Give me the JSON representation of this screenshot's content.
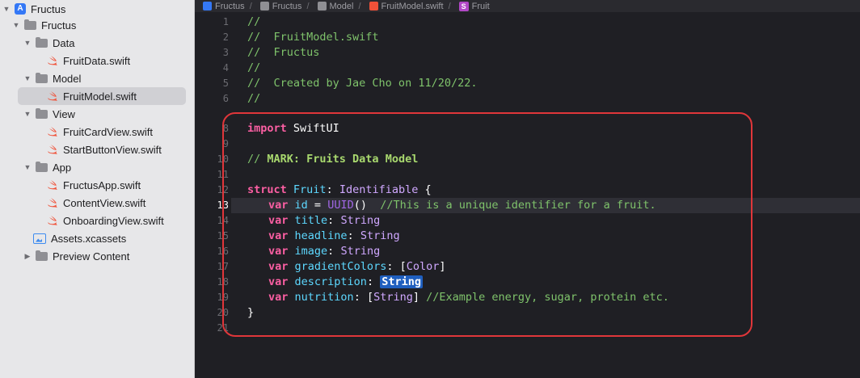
{
  "navigator": {
    "project": "Fructus",
    "group_root": "Fructus",
    "groups": {
      "data": "Data",
      "model": "Model",
      "view": "View",
      "app": "App"
    },
    "files": {
      "fruit_data": "FruitData.swift",
      "fruit_model": "FruitModel.swift",
      "fruit_card_view": "FruitCardView.swift",
      "start_button_view": "StartButtonView.swift",
      "fructus_app": "FructusApp.swift",
      "content_view": "ContentView.swift",
      "onboarding_view": "OnboardingView.swift",
      "assets": "Assets.xcassets",
      "preview_content": "Preview Content"
    }
  },
  "jumpbar": {
    "items": [
      "Fructus",
      "Fructus",
      "Model",
      "FruitModel.swift",
      "Fruit"
    ],
    "separator": "/"
  },
  "editor": {
    "line_numbers": [
      "1",
      "2",
      "3",
      "4",
      "5",
      "6",
      "8",
      "9",
      "10",
      "11",
      "12",
      "13",
      "14",
      "15",
      "16",
      "17",
      "18",
      "19",
      "20",
      "21"
    ],
    "lines": [
      {
        "text": "//"
      },
      {
        "text": "//  FruitModel.swift"
      },
      {
        "text": "//  Fructus"
      },
      {
        "text": "//"
      },
      {
        "text": "//  Created by Jae Cho on 11/20/22."
      },
      {
        "text": "//"
      },
      {
        "kw": "import",
        "rest": " SwiftUI"
      },
      {
        "text": ""
      },
      {
        "comment": "// ",
        "mark": "MARK: Fruits Data Model"
      },
      {
        "text": ""
      },
      {
        "kw": "struct",
        "name": "Fruit",
        "colon": ": ",
        "proto": "Identifiable",
        "brace": " {"
      },
      {
        "kw": "var",
        "prop": "id",
        "eq": " = ",
        "call": "UUID",
        "parens": "()",
        "comment": "  //This is a unique identifier for a fruit."
      },
      {
        "kw": "var",
        "prop": "title",
        "colon": ": ",
        "type": "String"
      },
      {
        "kw": "var",
        "prop": "headline",
        "colon": ": ",
        "type": "String"
      },
      {
        "kw": "var",
        "prop": "image",
        "colon": ": ",
        "type": "String"
      },
      {
        "kw": "var",
        "prop": "gradientColors",
        "colon": ": [",
        "type": "Color",
        "close": "]"
      },
      {
        "kw": "var",
        "prop": "description",
        "colon": ": ",
        "type": "String"
      },
      {
        "kw": "var",
        "prop": "nutrition",
        "colon": ": [",
        "type": "String",
        "close": "]",
        "comment": " //Example energy, sugar, protein etc."
      },
      {
        "text": "}"
      },
      {
        "text": ""
      }
    ]
  },
  "colors": {
    "keyword": "#fc5fa3",
    "comment": "#7fc36b",
    "type": "#d0a8ff",
    "property": "#5dd8ff",
    "selection": "#1f5fbf",
    "annotation_box": "#e0363a"
  }
}
